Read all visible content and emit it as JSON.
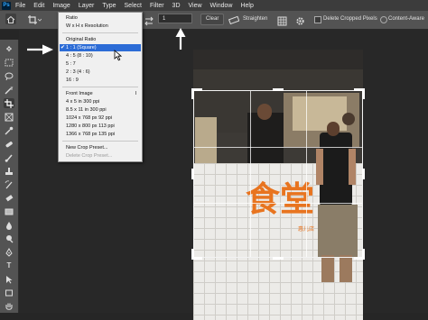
{
  "menu": {
    "logo": "Ps",
    "items": [
      "File",
      "Edit",
      "Image",
      "Layer",
      "Type",
      "Select",
      "Filter",
      "3D",
      "View",
      "Window",
      "Help"
    ]
  },
  "options": {
    "ratio_field_value": "1",
    "clear_label": "Clear",
    "straighten_label": "Straighten",
    "delete_cropped_label": "Delete Cropped Pixels",
    "content_aware_label": "Content-Aware"
  },
  "dropdown": {
    "items": [
      {
        "label": "Ratio",
        "type": "item"
      },
      {
        "label": "W x H x Resolution",
        "type": "item"
      },
      {
        "type": "sep"
      },
      {
        "label": "Original Ratio",
        "type": "item"
      },
      {
        "label": "1 : 1 (Square)",
        "type": "selected",
        "check": "✔"
      },
      {
        "label": "4 : 5 (8 : 10)",
        "type": "item"
      },
      {
        "label": "5 : 7",
        "type": "item"
      },
      {
        "label": "2 : 3 (4 : 6)",
        "type": "item"
      },
      {
        "label": "16 : 9",
        "type": "item"
      },
      {
        "type": "sep"
      },
      {
        "label": "Front Image",
        "type": "item",
        "suffix": "I"
      },
      {
        "label": "4 x 5 in 300 ppi",
        "type": "item"
      },
      {
        "label": "8.5 x 11 in 300 ppi",
        "type": "item"
      },
      {
        "label": "1024 x 768 px 92 ppi",
        "type": "item"
      },
      {
        "label": "1280 x 800 px 113 ppi",
        "type": "item"
      },
      {
        "label": "1366 x 768 px 135 ppi",
        "type": "item"
      },
      {
        "type": "sep"
      },
      {
        "label": "New Crop Preset...",
        "type": "item"
      },
      {
        "label": "Delete Crop Preset...",
        "type": "disabled"
      }
    ]
  },
  "photo": {
    "sign_chars": "食堂",
    "sign_small": "惠儿店"
  },
  "colors": {
    "accent_selected": "#2c6cd6",
    "sign_orange": "#e8741f"
  }
}
